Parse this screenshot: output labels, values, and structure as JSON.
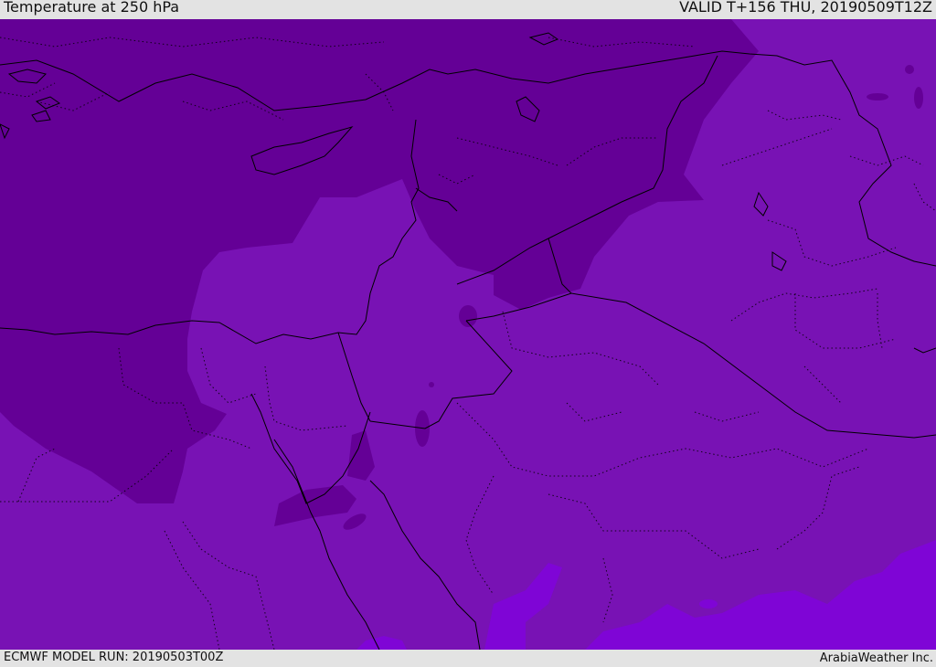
{
  "header": {
    "title": "Temperature at 250 hPa",
    "valid_time": "VALID T+156 THU, 20190509T12Z"
  },
  "footer": {
    "model_run": "ECMWF MODEL RUN: 20190503T00Z",
    "credit": "ArabiaWeather Inc."
  },
  "colors": {
    "cold_zone": "#640096",
    "mid_zone": "#7812b4",
    "warm_zone": "#7f05d6",
    "boundary": "#000000"
  }
}
